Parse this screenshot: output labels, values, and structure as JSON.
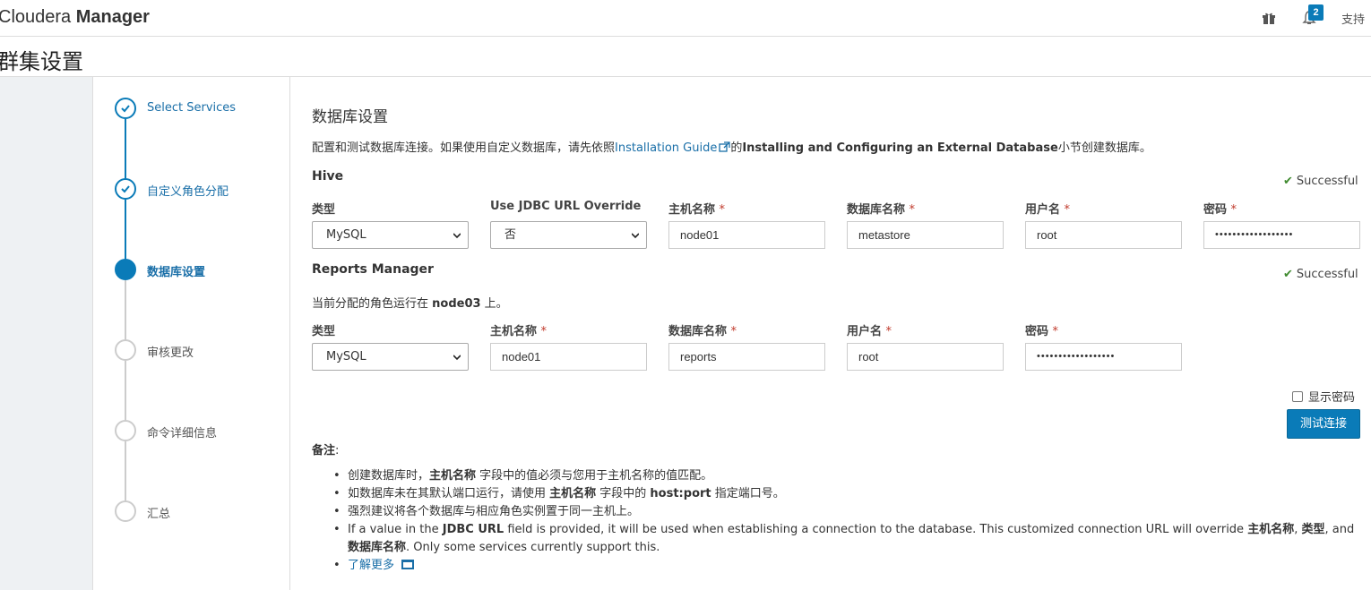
{
  "header": {
    "logo_light": "Cloudera ",
    "logo_bold": "Manager",
    "notification_count": "2",
    "support_label": "支持"
  },
  "page_title": "群集设置",
  "steps": [
    {
      "label": "Select Services",
      "state": "done"
    },
    {
      "label": "自定义角色分配",
      "state": "done"
    },
    {
      "label": "数据库设置",
      "state": "active"
    },
    {
      "label": "审核更改",
      "state": "pending"
    },
    {
      "label": "命令详细信息",
      "state": "pending"
    },
    {
      "label": "汇总",
      "state": "pending"
    }
  ],
  "main": {
    "title": "数据库设置",
    "intro_prefix": "配置和测试数据库连接。如果使用自定义数据库，请先依照",
    "intro_link": "Installation Guide",
    "intro_mid": "的",
    "intro_bold": "Installing and Configuring an External Database",
    "intro_suffix": "小节创建数据库。"
  },
  "hive": {
    "title": "Hive",
    "status": "Successful",
    "labels": {
      "type": "类型",
      "jdbc": "Use JDBC URL Override",
      "host": "主机名称",
      "dbname": "数据库名称",
      "user": "用户名",
      "password": "密码"
    },
    "values": {
      "type": "MySQL",
      "jdbc": "否",
      "host": "node01",
      "dbname": "metastore",
      "user": "root",
      "password": "••••••••••••••••••"
    }
  },
  "reports": {
    "title": "Reports Manager",
    "status": "Successful",
    "role_note_prefix": "当前分配的角色运行在 ",
    "role_note_host": "node03",
    "role_note_suffix": " 上。",
    "labels": {
      "type": "类型",
      "host": "主机名称",
      "dbname": "数据库名称",
      "user": "用户名",
      "password": "密码"
    },
    "values": {
      "type": "MySQL",
      "host": "node01",
      "dbname": "reports",
      "user": "root",
      "password": "••••••••••••••••••"
    }
  },
  "required_mark": "*",
  "show_password_label": "显示密码",
  "test_button_label": "测试连接",
  "notes": {
    "title": "备注",
    "colon": ":",
    "n1_a": "创建数据库时，",
    "n1_b": "主机名称",
    "n1_c": " 字段中的值必须与您用于主机名称的值匹配。",
    "n2_a": "如数据库未在其默认端口运行，请使用 ",
    "n2_b": "主机名称",
    "n2_c": " 字段中的 ",
    "n2_d": "host:port",
    "n2_e": " 指定端口号。",
    "n3": "强烈建议将各个数据库与相应角色实例置于同一主机上。",
    "n4_a": "If a value in the ",
    "n4_b": "JDBC URL",
    "n4_c": " field is provided, it will be used when establishing a connection to the database. This customized connection URL will override ",
    "n4_d": "主机名称",
    "n4_e": ", ",
    "n4_f": "类型",
    "n4_g": ", and ",
    "n4_h": "数据库名称",
    "n4_i": ". Only some services currently support this.",
    "learn_more": "了解更多"
  },
  "colors": {
    "accent": "#0a7bb8",
    "success": "#3f8a2f",
    "required": "#c0392b"
  }
}
